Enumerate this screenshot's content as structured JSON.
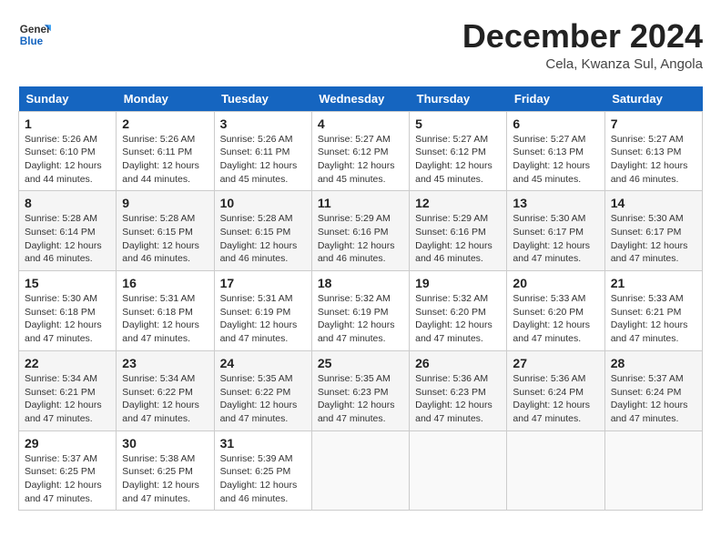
{
  "header": {
    "logo": {
      "line1": "General",
      "line2": "Blue"
    },
    "title": "December 2024",
    "location": "Cela, Kwanza Sul, Angola"
  },
  "calendar": {
    "days_of_week": [
      "Sunday",
      "Monday",
      "Tuesday",
      "Wednesday",
      "Thursday",
      "Friday",
      "Saturday"
    ],
    "weeks": [
      [
        null,
        {
          "day": "2",
          "sunrise": "Sunrise: 5:26 AM",
          "sunset": "Sunset: 6:11 PM",
          "daylight": "Daylight: 12 hours and 44 minutes."
        },
        {
          "day": "3",
          "sunrise": "Sunrise: 5:26 AM",
          "sunset": "Sunset: 6:11 PM",
          "daylight": "Daylight: 12 hours and 45 minutes."
        },
        {
          "day": "4",
          "sunrise": "Sunrise: 5:27 AM",
          "sunset": "Sunset: 6:12 PM",
          "daylight": "Daylight: 12 hours and 45 minutes."
        },
        {
          "day": "5",
          "sunrise": "Sunrise: 5:27 AM",
          "sunset": "Sunset: 6:12 PM",
          "daylight": "Daylight: 12 hours and 45 minutes."
        },
        {
          "day": "6",
          "sunrise": "Sunrise: 5:27 AM",
          "sunset": "Sunset: 6:13 PM",
          "daylight": "Daylight: 12 hours and 45 minutes."
        },
        {
          "day": "7",
          "sunrise": "Sunrise: 5:27 AM",
          "sunset": "Sunset: 6:13 PM",
          "daylight": "Daylight: 12 hours and 46 minutes."
        }
      ],
      [
        {
          "day": "1",
          "sunrise": "Sunrise: 5:26 AM",
          "sunset": "Sunset: 6:10 PM",
          "daylight": "Daylight: 12 hours and 44 minutes."
        },
        {
          "day": "9",
          "sunrise": "Sunrise: 5:28 AM",
          "sunset": "Sunset: 6:15 PM",
          "daylight": "Daylight: 12 hours and 46 minutes."
        },
        {
          "day": "10",
          "sunrise": "Sunrise: 5:28 AM",
          "sunset": "Sunset: 6:15 PM",
          "daylight": "Daylight: 12 hours and 46 minutes."
        },
        {
          "day": "11",
          "sunrise": "Sunrise: 5:29 AM",
          "sunset": "Sunset: 6:16 PM",
          "daylight": "Daylight: 12 hours and 46 minutes."
        },
        {
          "day": "12",
          "sunrise": "Sunrise: 5:29 AM",
          "sunset": "Sunset: 6:16 PM",
          "daylight": "Daylight: 12 hours and 46 minutes."
        },
        {
          "day": "13",
          "sunrise": "Sunrise: 5:30 AM",
          "sunset": "Sunset: 6:17 PM",
          "daylight": "Daylight: 12 hours and 47 minutes."
        },
        {
          "day": "14",
          "sunrise": "Sunrise: 5:30 AM",
          "sunset": "Sunset: 6:17 PM",
          "daylight": "Daylight: 12 hours and 47 minutes."
        }
      ],
      [
        {
          "day": "8",
          "sunrise": "Sunrise: 5:28 AM",
          "sunset": "Sunset: 6:14 PM",
          "daylight": "Daylight: 12 hours and 46 minutes."
        },
        {
          "day": "16",
          "sunrise": "Sunrise: 5:31 AM",
          "sunset": "Sunset: 6:18 PM",
          "daylight": "Daylight: 12 hours and 47 minutes."
        },
        {
          "day": "17",
          "sunrise": "Sunrise: 5:31 AM",
          "sunset": "Sunset: 6:19 PM",
          "daylight": "Daylight: 12 hours and 47 minutes."
        },
        {
          "day": "18",
          "sunrise": "Sunrise: 5:32 AM",
          "sunset": "Sunset: 6:19 PM",
          "daylight": "Daylight: 12 hours and 47 minutes."
        },
        {
          "day": "19",
          "sunrise": "Sunrise: 5:32 AM",
          "sunset": "Sunset: 6:20 PM",
          "daylight": "Daylight: 12 hours and 47 minutes."
        },
        {
          "day": "20",
          "sunrise": "Sunrise: 5:33 AM",
          "sunset": "Sunset: 6:20 PM",
          "daylight": "Daylight: 12 hours and 47 minutes."
        },
        {
          "day": "21",
          "sunrise": "Sunrise: 5:33 AM",
          "sunset": "Sunset: 6:21 PM",
          "daylight": "Daylight: 12 hours and 47 minutes."
        }
      ],
      [
        {
          "day": "15",
          "sunrise": "Sunrise: 5:30 AM",
          "sunset": "Sunset: 6:18 PM",
          "daylight": "Daylight: 12 hours and 47 minutes."
        },
        {
          "day": "23",
          "sunrise": "Sunrise: 5:34 AM",
          "sunset": "Sunset: 6:22 PM",
          "daylight": "Daylight: 12 hours and 47 minutes."
        },
        {
          "day": "24",
          "sunrise": "Sunrise: 5:35 AM",
          "sunset": "Sunset: 6:22 PM",
          "daylight": "Daylight: 12 hours and 47 minutes."
        },
        {
          "day": "25",
          "sunrise": "Sunrise: 5:35 AM",
          "sunset": "Sunset: 6:23 PM",
          "daylight": "Daylight: 12 hours and 47 minutes."
        },
        {
          "day": "26",
          "sunrise": "Sunrise: 5:36 AM",
          "sunset": "Sunset: 6:23 PM",
          "daylight": "Daylight: 12 hours and 47 minutes."
        },
        {
          "day": "27",
          "sunrise": "Sunrise: 5:36 AM",
          "sunset": "Sunset: 6:24 PM",
          "daylight": "Daylight: 12 hours and 47 minutes."
        },
        {
          "day": "28",
          "sunrise": "Sunrise: 5:37 AM",
          "sunset": "Sunset: 6:24 PM",
          "daylight": "Daylight: 12 hours and 47 minutes."
        }
      ],
      [
        {
          "day": "22",
          "sunrise": "Sunrise: 5:34 AM",
          "sunset": "Sunset: 6:21 PM",
          "daylight": "Daylight: 12 hours and 47 minutes."
        },
        {
          "day": "30",
          "sunrise": "Sunrise: 5:38 AM",
          "sunset": "Sunset: 6:25 PM",
          "daylight": "Daylight: 12 hours and 47 minutes."
        },
        {
          "day": "31",
          "sunrise": "Sunrise: 5:39 AM",
          "sunset": "Sunset: 6:25 PM",
          "daylight": "Daylight: 12 hours and 46 minutes."
        },
        null,
        null,
        null,
        null
      ],
      [
        {
          "day": "29",
          "sunrise": "Sunrise: 5:37 AM",
          "sunset": "Sunset: 6:25 PM",
          "daylight": "Daylight: 12 hours and 47 minutes."
        },
        null,
        null,
        null,
        null,
        null,
        null
      ]
    ]
  }
}
